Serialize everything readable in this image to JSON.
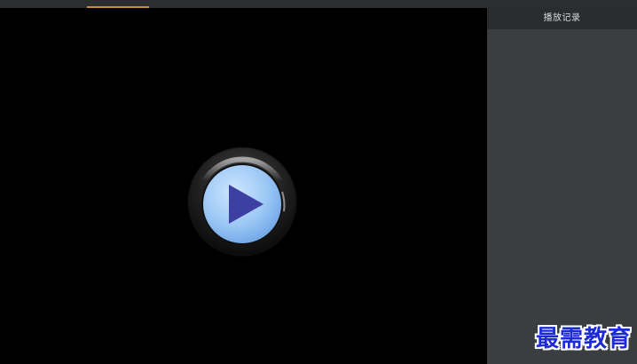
{
  "side_panel": {
    "title": "播放记录"
  },
  "player": {
    "play_icon": "play-icon"
  },
  "watermark": {
    "text": "最需教育"
  },
  "colors": {
    "accent": "#c98a3a",
    "panel_bg": "#3a3e40",
    "header_bg": "#2a2c2e",
    "watermark": "#1d2bd6"
  }
}
